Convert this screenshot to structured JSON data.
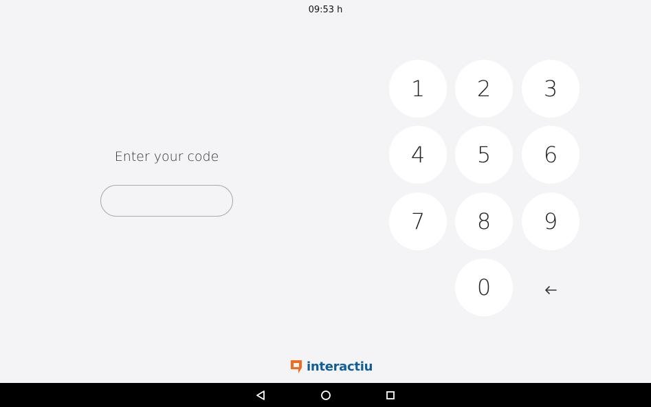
{
  "status_bar": {
    "time": "09:53 h"
  },
  "login": {
    "prompt": "Enter your code",
    "code_value": "",
    "code_placeholder": ""
  },
  "keypad": {
    "keys": [
      "1",
      "2",
      "3",
      "4",
      "5",
      "6",
      "7",
      "8",
      "9",
      "0"
    ],
    "backspace_icon": "arrow-left-icon"
  },
  "branding": {
    "logo_text": "interactiu",
    "logo_mark_color": "#f26b1d",
    "logo_text_color": "#0f5e9c"
  },
  "navbar": {
    "icons": [
      "back-triangle-icon",
      "home-circle-icon",
      "recents-square-icon"
    ]
  }
}
